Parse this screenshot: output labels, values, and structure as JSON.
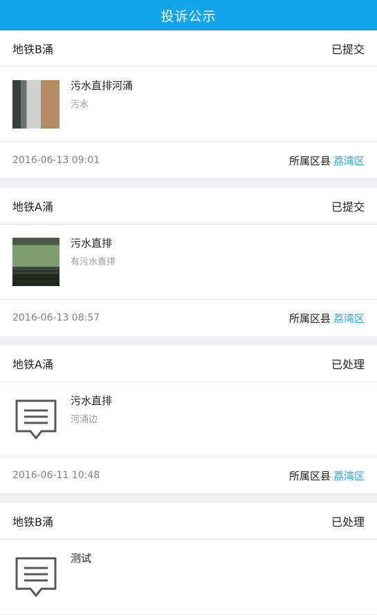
{
  "header": {
    "title": "投诉公示"
  },
  "items": [
    {
      "river": "地铁B涌",
      "status": "已提交",
      "thumb": "photo1",
      "title": "污水直排河涌",
      "desc": "污水",
      "date": "2016-06-13 09:01",
      "area_label": "所属区县",
      "area": "荔湾区"
    },
    {
      "river": "地铁A涌",
      "status": "已提交",
      "thumb": "photo2",
      "title": "污水直排",
      "desc": "有污水直排",
      "date": "2016-06-13 08:57",
      "area_label": "所属区县",
      "area": "荔湾区"
    },
    {
      "river": "地铁A涌",
      "status": "已处理",
      "thumb": "message-icon",
      "title": "污水直排",
      "desc": "河涌边",
      "date": "2016-06-11 10:48",
      "area_label": "所属区县",
      "area": "荔湾区"
    },
    {
      "river": "地铁B涌",
      "status": "已处理",
      "thumb": "message-icon",
      "title": "测试",
      "desc": "",
      "date": "",
      "area_label": "",
      "area": ""
    }
  ],
  "colors": {
    "header_bg": "#12a5ec",
    "area_link": "#29a2e3"
  }
}
